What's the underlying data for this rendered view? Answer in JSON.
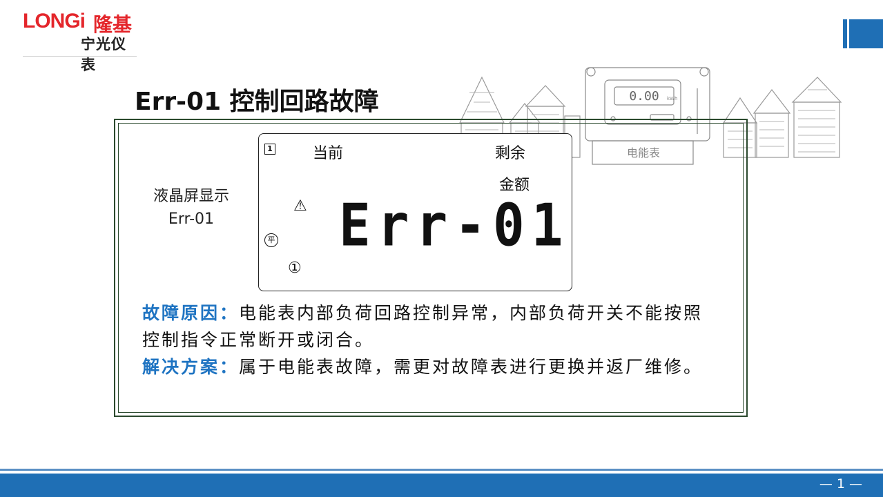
{
  "logo": {
    "brand": "LONGi",
    "brand_cn": "隆基",
    "sub": "宁光仪表"
  },
  "slide": {
    "title": "Err-01 控制回路故障"
  },
  "meter_illustration": {
    "reading": "0.00",
    "unit": "kWh",
    "label": "电能表"
  },
  "lcd_caption": {
    "line1": "液晶屏显示",
    "line2": "Err-01"
  },
  "lcd": {
    "indicator_1": "1",
    "current_label": "当前",
    "remaining_label": "剩余",
    "amount_label": "金额",
    "error_code": "Err-01",
    "warning_symbol": "⚠",
    "flat_symbol": "平",
    "circle_one": "①"
  },
  "description": {
    "cause_label": "故障原因：",
    "cause_text": "电能表内部负荷回路控制异常，内部负荷开关不能按照控制指令正常断开或闭合。",
    "solution_label": "解决方案：",
    "solution_text": "属于电能表故障，需更对故障表进行更换并返厂维修。"
  },
  "footer": {
    "page": "— 1 —"
  },
  "colors": {
    "brand_red": "#e4262b",
    "accent_blue": "#1f74c2",
    "footer_blue": "#1f6fb5",
    "panel_border": "#2b4a2e"
  }
}
